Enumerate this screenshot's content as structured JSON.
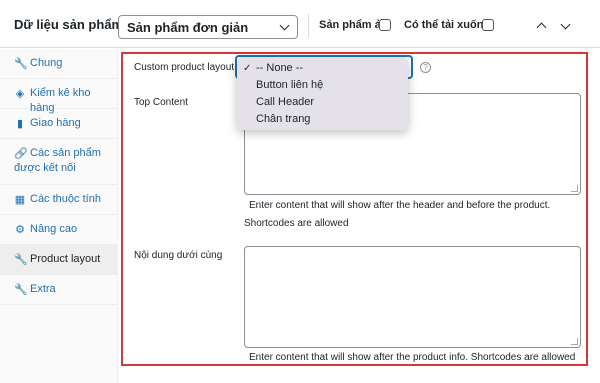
{
  "header": {
    "title": "Dữ liệu sản phẩm —",
    "product_type": "Sản phẩm đơn giản",
    "virtual_label": "Sản phẩm ảo:",
    "downloadable_label": "Có thể tải xuống:",
    "virtual_checked": false,
    "downloadable_checked": false
  },
  "sidebar": {
    "items": [
      {
        "label": "Chung",
        "icon": "wrench-icon",
        "glyph": "🔧"
      },
      {
        "label": "Kiểm kê kho hàng",
        "icon": "tag-icon",
        "glyph": "◈"
      },
      {
        "label": "Giao hàng",
        "icon": "truck-icon",
        "glyph": "▮"
      },
      {
        "label_line1": "Các sản phẩm",
        "label_line2": "được kết nối",
        "icon": "link-icon",
        "glyph": "🔗"
      },
      {
        "label": "Các thuộc tính",
        "icon": "list-icon",
        "glyph": "▦"
      },
      {
        "label": "Nâng cao",
        "icon": "gear-icon",
        "glyph": "⚙"
      },
      {
        "label": "Product layout",
        "icon": "wrench-icon",
        "glyph": "🔧"
      },
      {
        "label": "Extra",
        "icon": "wrench-icon",
        "glyph": "🔧"
      }
    ],
    "active_index": 6
  },
  "main": {
    "layout_label": "Custom product layout",
    "layout_help": "?",
    "top_content_label": "Top Content",
    "top_content_value": "",
    "top_desc": "Enter content that will show after the header and before the product.",
    "shortcodes_note": "Shortcodes are allowed",
    "bottom_content_label": "Nội dung dưới cùng",
    "bottom_content_value": "",
    "bottom_desc": "Enter content that will show after the product info. Shortcodes are allowed"
  },
  "dropdown": {
    "options": [
      {
        "label": "-- None --",
        "selected": true,
        "check": "✓"
      },
      {
        "label": "Button liên hệ",
        "selected": false,
        "check": ""
      },
      {
        "label": "Call Header",
        "selected": false,
        "check": ""
      },
      {
        "label": "Chân trang",
        "selected": false,
        "check": ""
      }
    ]
  },
  "colors": {
    "accent": "#2271b1",
    "highlight_border": "#d63638",
    "menu_background": "#e5e1ea"
  }
}
